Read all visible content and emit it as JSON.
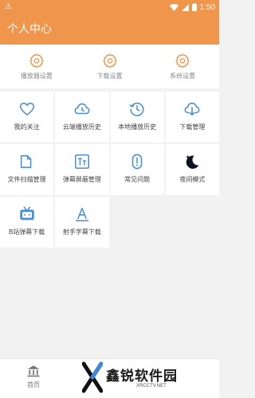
{
  "status_bar": {
    "warning_glyph": "⚠",
    "time": "1:50"
  },
  "header": {
    "title": "个人中心"
  },
  "settings": [
    {
      "label": "播放器设置",
      "icon": "gear-icon"
    },
    {
      "label": "下载设置",
      "icon": "gear-icon"
    },
    {
      "label": "系统设置",
      "icon": "gear-icon"
    }
  ],
  "grid": [
    {
      "label": "我的关注",
      "icon": "heart-icon"
    },
    {
      "label": "云端播放历史",
      "icon": "cloud-clock-icon"
    },
    {
      "label": "本地播放历史",
      "icon": "clock-history-icon"
    },
    {
      "label": "下载管理",
      "icon": "cloud-download-icon"
    },
    {
      "label": "文件扫描管理",
      "icon": "folder-icon"
    },
    {
      "label": "弹幕屏蔽管理",
      "icon": "text-block-icon"
    },
    {
      "label": "常见问题",
      "icon": "info-icon"
    },
    {
      "label": "夜间模式",
      "icon": "moon-icon"
    },
    {
      "label": "B站弹幕下载",
      "icon": "tv-icon"
    },
    {
      "label": "射手字幕下载",
      "icon": "subtitle-a-icon"
    }
  ],
  "bottom_nav": {
    "home_label": "首页"
  },
  "watermark": {
    "brand": "鑫锐软件园",
    "url": "XRCCTV.NET"
  },
  "colors": {
    "accent": "#f0954c",
    "icon_blue": "#4a8fd6"
  }
}
